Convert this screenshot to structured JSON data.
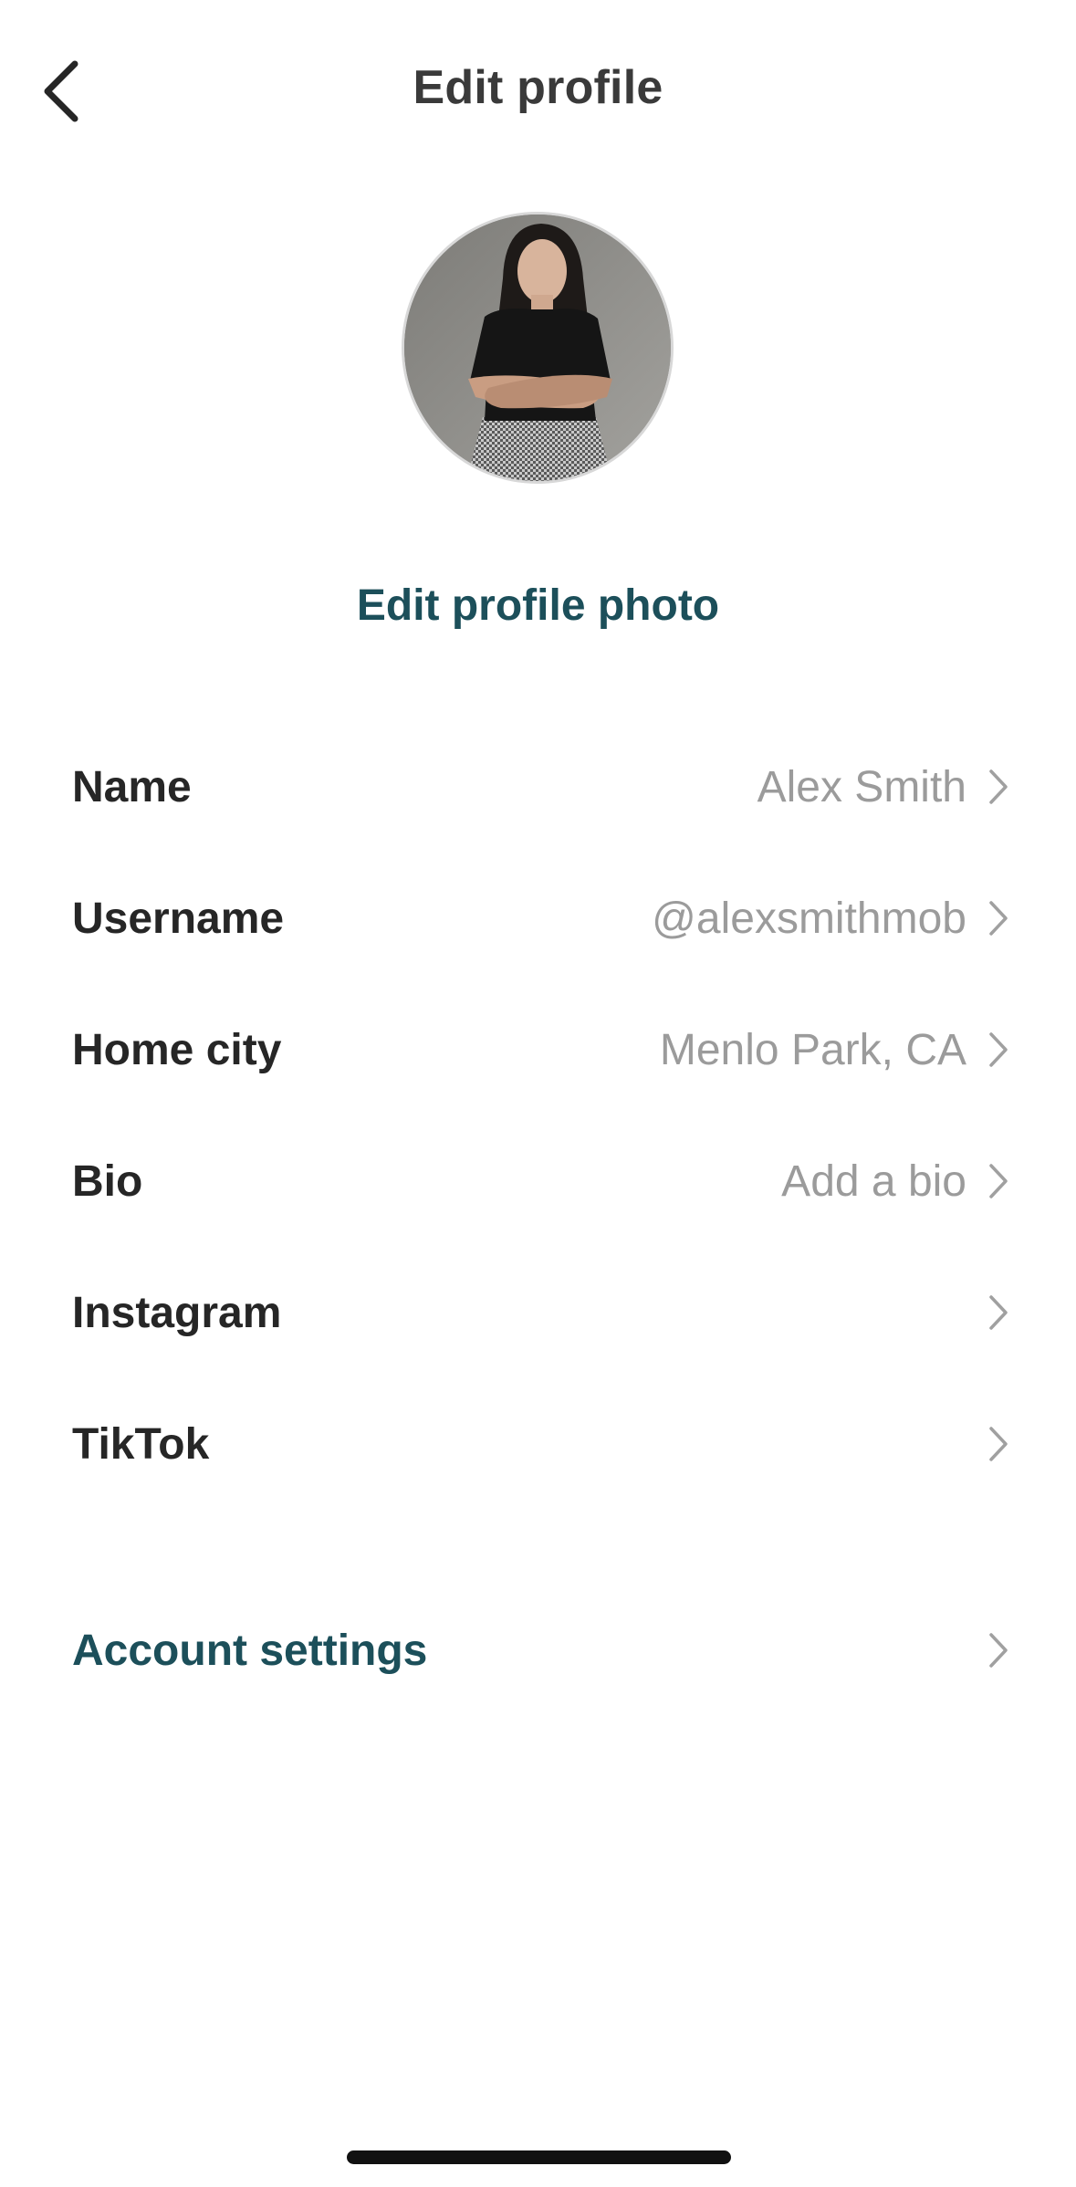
{
  "header": {
    "title": "Edit profile",
    "back_icon": "chevron-left-icon"
  },
  "profile": {
    "avatar_alt": "profile photo",
    "edit_photo_label": "Edit profile photo"
  },
  "fields": [
    {
      "label": "Name",
      "value": "Alex Smith"
    },
    {
      "label": "Username",
      "value": "@alexsmithmob"
    },
    {
      "label": "Home city",
      "value": "Menlo Park, CA"
    },
    {
      "label": "Bio",
      "value": "Add a bio"
    },
    {
      "label": "Instagram",
      "value": ""
    },
    {
      "label": "TikTok",
      "value": ""
    }
  ],
  "account": {
    "settings_label": "Account settings"
  },
  "colors": {
    "accent": "#1c4f5a",
    "label": "#262626",
    "value": "#9b9b9b",
    "chevron": "#a0a0a0"
  }
}
